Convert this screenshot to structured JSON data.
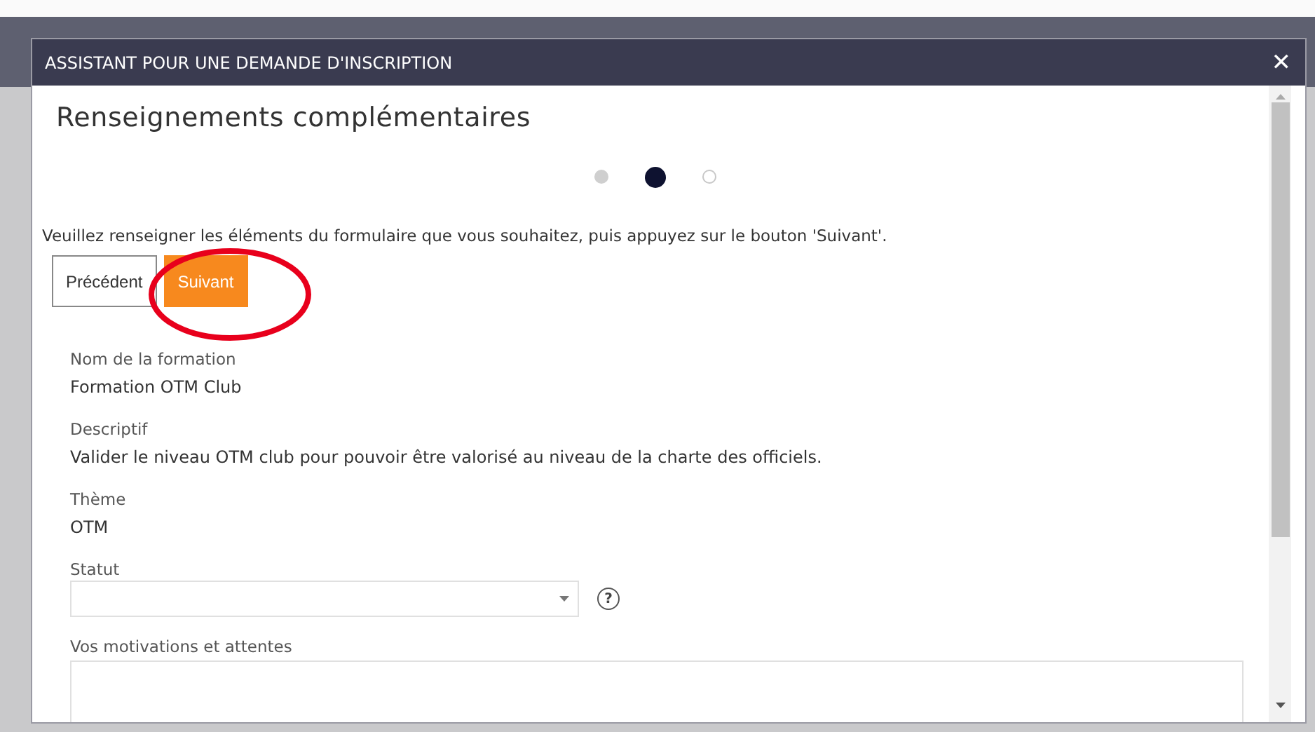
{
  "dialog": {
    "title": "ASSISTANT POUR UNE DEMANDE D'INSCRIPTION",
    "close": "✕"
  },
  "heading": "Renseignements complémentaires",
  "steps": [
    {
      "completed": true,
      "selected": false
    },
    {
      "completed": false,
      "selected": true
    },
    {
      "completed": false,
      "selected": false
    }
  ],
  "instruction": "Veuillez renseigner les éléments du formulaire que vous souhaitez, puis appuyez sur le bouton 'Suivant'.",
  "buttons": [
    {
      "label": "Précédent",
      "kind": "secondary"
    },
    {
      "label": "Suivant",
      "kind": "primary"
    }
  ],
  "annotation": {
    "kind": "ellipse",
    "color": "#e8001c"
  },
  "fields": [
    {
      "kind": "info",
      "label": "Nom de la formation",
      "value": "Formation OTM Club"
    },
    {
      "kind": "info",
      "label": "Descriptif",
      "value": "Valider le niveau OTM club pour pouvoir être valorisé au niveau de la charte des officiels."
    },
    {
      "kind": "info",
      "label": "Thème",
      "value": "OTM"
    },
    {
      "kind": "select",
      "label": "Statut",
      "help": "?"
    },
    {
      "kind": "textarea",
      "label": "Vos motivations et attentes"
    }
  ]
}
